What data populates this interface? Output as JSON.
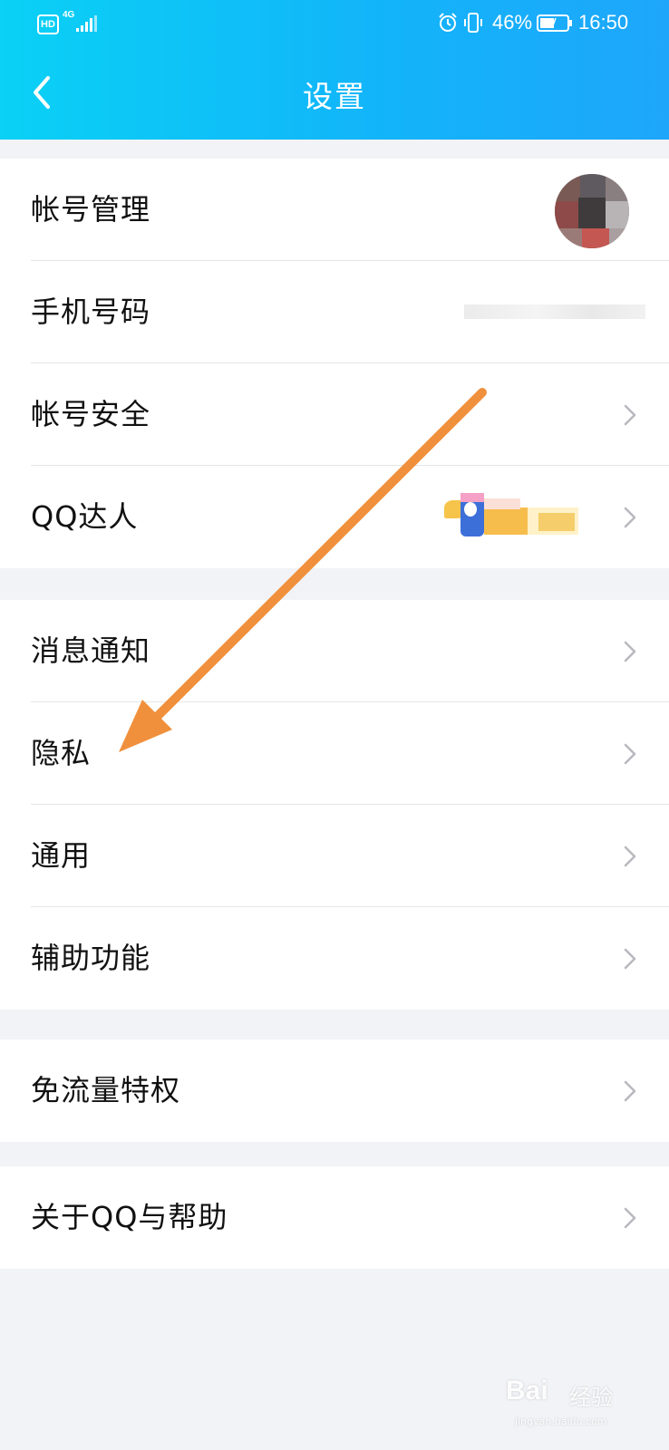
{
  "status_bar": {
    "hd": "HD",
    "network": "4G",
    "battery_percent": "46%",
    "time": "16:50"
  },
  "header": {
    "title": "设置",
    "back_icon": "chevron-left-icon"
  },
  "groups": [
    {
      "items": [
        {
          "label": "帐号管理",
          "accessory": "avatar"
        },
        {
          "label": "手机号码",
          "accessory": "masked-value"
        },
        {
          "label": "帐号安全",
          "accessory": "chevron-right-icon"
        },
        {
          "label": "QQ达人",
          "accessory": "badge-and-chevron"
        }
      ]
    },
    {
      "items": [
        {
          "label": "消息通知",
          "accessory": "chevron-right-icon"
        },
        {
          "label": "隐私",
          "accessory": "chevron-right-icon"
        },
        {
          "label": "通用",
          "accessory": "chevron-right-icon"
        },
        {
          "label": "辅助功能",
          "accessory": "chevron-right-icon"
        }
      ]
    },
    {
      "items": [
        {
          "label": "免流量特权",
          "accessory": "chevron-right-icon"
        }
      ]
    },
    {
      "items": [
        {
          "label": "关于QQ与帮助",
          "accessory": "chevron-right-icon"
        }
      ]
    }
  ],
  "annotation": {
    "color": "#f0903c",
    "icon": "orange-arrow"
  },
  "watermark": {
    "brand": "Bai",
    "brand_suffix": "经验",
    "url": "jingyan.baidu.com"
  },
  "colors": {
    "header_gradient_start": "#0ad1f5",
    "header_gradient_end": "#1ea6fb",
    "background": "#f2f3f7",
    "chevron": "#b8b8be"
  }
}
